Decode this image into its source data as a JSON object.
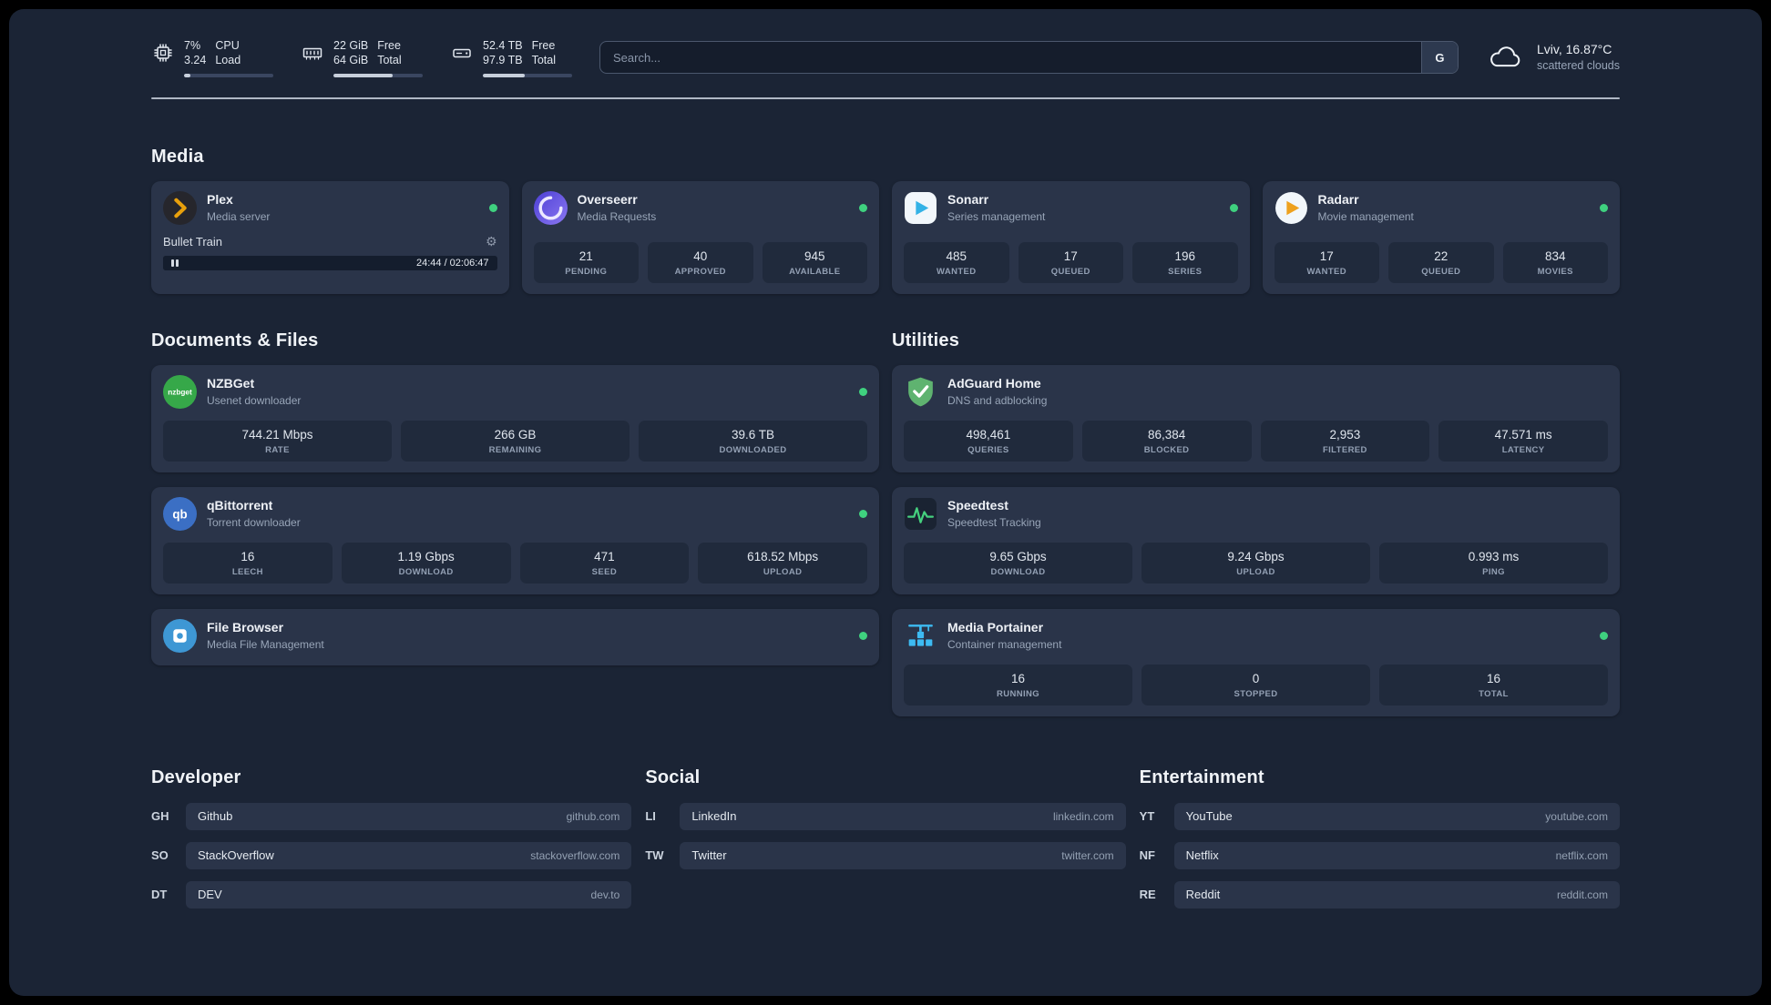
{
  "topbar": {
    "cpu": {
      "value_top": "7%",
      "value_bottom": "3.24",
      "label_top": "CPU",
      "label_bottom": "Load",
      "bar_pct": 7
    },
    "ram": {
      "value_top": "22 GiB",
      "value_bottom": "64 GiB",
      "label_top": "Free",
      "label_bottom": "Total",
      "bar_pct": 66
    },
    "disk": {
      "value_top": "52.4 TB",
      "value_bottom": "97.9 TB",
      "label_top": "Free",
      "label_bottom": "Total",
      "bar_pct": 47
    },
    "search": {
      "placeholder": "Search...",
      "button_label": "G"
    },
    "weather": {
      "location": "Lviv, 16.87°C",
      "condition": "scattered clouds"
    }
  },
  "icons": {
    "gear": "⚙"
  },
  "colors": {
    "background": "#1b2435",
    "card": "#2a3449",
    "status_green": "#3fd17f",
    "plex_orange": "#e8a00c",
    "overseerr_purple": "#6a5cf0",
    "sonarr_blue": "#33b2e6",
    "radarr_orange": "#eea11e",
    "nzbget_green": "#36a849",
    "qbittorrent_blue": "#3b6fc4",
    "filebrowser_blue": "#3e97d4",
    "adguard_green": "#5fb370",
    "speedtest_green": "#45d07e",
    "portainer_blue": "#3dbbf2"
  },
  "sections": {
    "media": {
      "title": "Media",
      "plex": {
        "name": "Plex",
        "subtitle": "Media server",
        "now_playing": "Bullet Train",
        "time": "24:44 / 02:06:47",
        "progress_pct": 19
      },
      "overseerr": {
        "name": "Overseerr",
        "subtitle": "Media Requests",
        "stats": [
          {
            "value": "21",
            "label": "PENDING"
          },
          {
            "value": "40",
            "label": "APPROVED"
          },
          {
            "value": "945",
            "label": "AVAILABLE"
          }
        ]
      },
      "sonarr": {
        "name": "Sonarr",
        "subtitle": "Series management",
        "stats": [
          {
            "value": "485",
            "label": "WANTED"
          },
          {
            "value": "17",
            "label": "QUEUED"
          },
          {
            "value": "196",
            "label": "SERIES"
          }
        ]
      },
      "radarr": {
        "name": "Radarr",
        "subtitle": "Movie management",
        "stats": [
          {
            "value": "17",
            "label": "WANTED"
          },
          {
            "value": "22",
            "label": "QUEUED"
          },
          {
            "value": "834",
            "label": "MOVIES"
          }
        ]
      }
    },
    "documents": {
      "title": "Documents & Files",
      "nzbget": {
        "name": "NZBGet",
        "subtitle": "Usenet downloader",
        "icon_text": "nzbget",
        "stats": [
          {
            "value": "744.21 Mbps",
            "label": "RATE"
          },
          {
            "value": "266 GB",
            "label": "REMAINING"
          },
          {
            "value": "39.6 TB",
            "label": "DOWNLOADED"
          }
        ]
      },
      "qbittorrent": {
        "name": "qBittorrent",
        "subtitle": "Torrent downloader",
        "icon_text": "qb",
        "stats": [
          {
            "value": "16",
            "label": "LEECH"
          },
          {
            "value": "1.19 Gbps",
            "label": "DOWNLOAD"
          },
          {
            "value": "471",
            "label": "SEED"
          },
          {
            "value": "618.52 Mbps",
            "label": "UPLOAD"
          }
        ]
      },
      "filebrowser": {
        "name": "File Browser",
        "subtitle": "Media File Management"
      }
    },
    "utilities": {
      "title": "Utilities",
      "adguard": {
        "name": "AdGuard Home",
        "subtitle": "DNS and adblocking",
        "stats": [
          {
            "value": "498,461",
            "label": "QUERIES"
          },
          {
            "value": "86,384",
            "label": "BLOCKED"
          },
          {
            "value": "2,953",
            "label": "FILTERED"
          },
          {
            "value": "47.571 ms",
            "label": "LATENCY"
          }
        ]
      },
      "speedtest": {
        "name": "Speedtest",
        "subtitle": "Speedtest Tracking",
        "stats": [
          {
            "value": "9.65 Gbps",
            "label": "DOWNLOAD"
          },
          {
            "value": "9.24 Gbps",
            "label": "UPLOAD"
          },
          {
            "value": "0.993 ms",
            "label": "PING"
          }
        ]
      },
      "portainer": {
        "name": "Media Portainer",
        "subtitle": "Container management",
        "stats": [
          {
            "value": "16",
            "label": "RUNNING"
          },
          {
            "value": "0",
            "label": "STOPPED"
          },
          {
            "value": "16",
            "label": "TOTAL"
          }
        ]
      }
    },
    "bookmarks": [
      {
        "title": "Developer",
        "items": [
          {
            "abbr": "GH",
            "name": "Github",
            "url": "github.com"
          },
          {
            "abbr": "SO",
            "name": "StackOverflow",
            "url": "stackoverflow.com"
          },
          {
            "abbr": "DT",
            "name": "DEV",
            "url": "dev.to"
          }
        ]
      },
      {
        "title": "Social",
        "items": [
          {
            "abbr": "LI",
            "name": "LinkedIn",
            "url": "linkedin.com"
          },
          {
            "abbr": "TW",
            "name": "Twitter",
            "url": "twitter.com"
          }
        ]
      },
      {
        "title": "Entertainment",
        "items": [
          {
            "abbr": "YT",
            "name": "YouTube",
            "url": "youtube.com"
          },
          {
            "abbr": "NF",
            "name": "Netflix",
            "url": "netflix.com"
          },
          {
            "abbr": "RE",
            "name": "Reddit",
            "url": "reddit.com"
          }
        ]
      }
    ]
  }
}
